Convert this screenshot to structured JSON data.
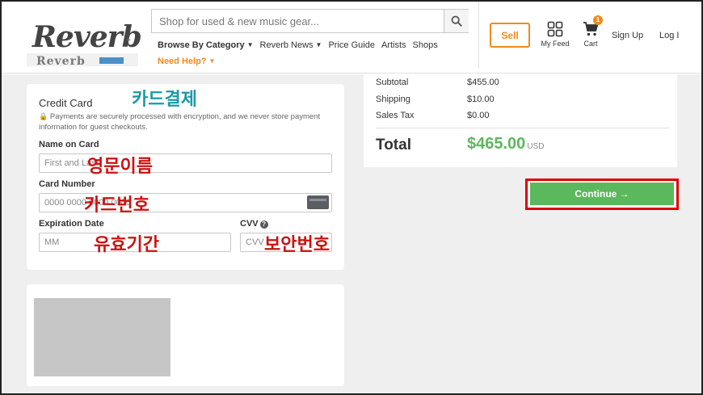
{
  "header": {
    "logo_text": "Reverb",
    "logo_subtext": "Reverb",
    "search_placeholder": "Shop for used & new music gear...",
    "nav": [
      {
        "label": "Browse By Category"
      },
      {
        "label": "Reverb News"
      },
      {
        "label": "Price Guide"
      },
      {
        "label": "Artists"
      },
      {
        "label": "Shops"
      }
    ],
    "help_label": "Need Help?",
    "sell_label": "Sell",
    "feed_label": "My Feed",
    "cart_label": "Cart",
    "cart_count": "1",
    "signup_label": "Sign Up",
    "login_label": "Log I"
  },
  "credit_card": {
    "title": "Credit Card",
    "note": "Payments are securely processed with encryption, and we never store payment information for guest checkouts.",
    "name_label": "Name on Card",
    "name_placeholder": "First and Last",
    "number_label": "Card Number",
    "number_placeholder": "0000 0000 0000 0000",
    "exp_label": "Expiration Date",
    "month_placeholder": "MM",
    "cvv_label": "CVV",
    "cvv_placeholder": "CVV"
  },
  "annotations": {
    "card_payment": "카드결제",
    "english_name": "영문이름",
    "card_number": "카드번호",
    "expiry": "유효기간",
    "security_code": "보안번호"
  },
  "summary": {
    "rows": [
      {
        "label": "Subtotal",
        "value": "$455.00"
      },
      {
        "label": "Shipping",
        "value": "$10.00"
      },
      {
        "label": "Sales Tax",
        "value": "$0.00"
      }
    ],
    "total_label": "Total",
    "total_value": "$465.00",
    "currency": "USD"
  },
  "continue_label": "Continue →",
  "colors": {
    "accent_orange": "#f08a1d",
    "total_green": "#5cb85c",
    "highlight_red": "#e00000",
    "annotation_teal": "#1b9aa8",
    "annotation_red": "#cc1111"
  }
}
